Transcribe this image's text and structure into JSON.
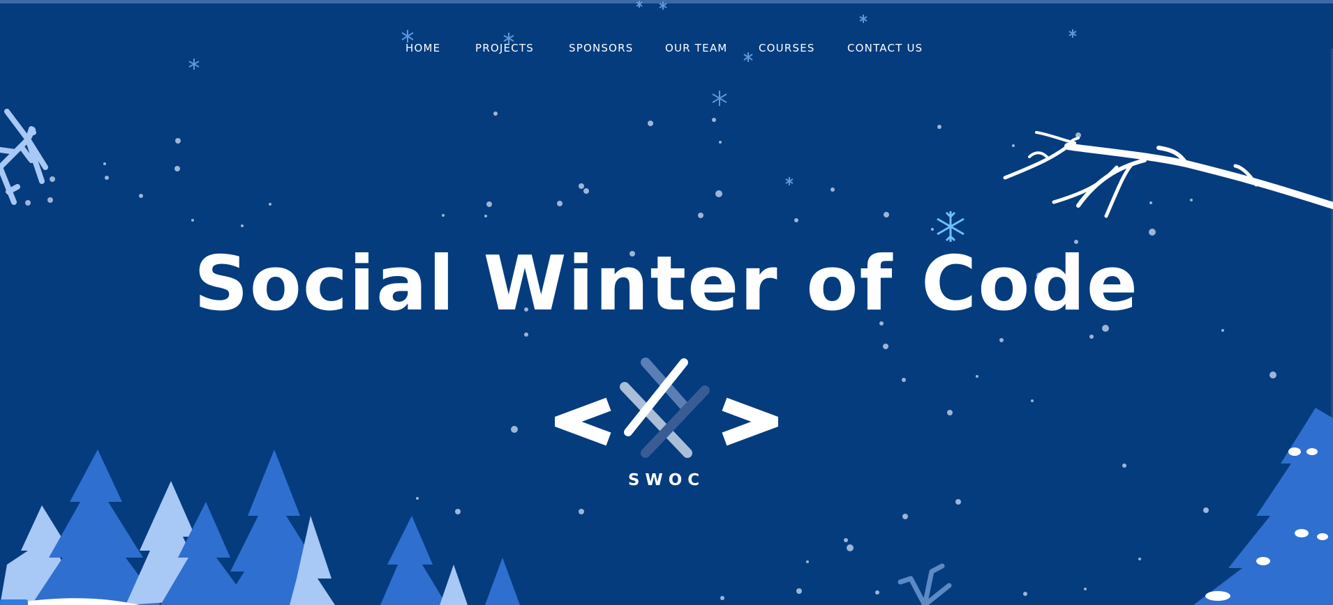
{
  "nav": {
    "items": [
      {
        "label": "HOME"
      },
      {
        "label": "PROJECTS"
      },
      {
        "label": "SPONSORS"
      },
      {
        "label": "OUR TEAM"
      },
      {
        "label": "COURSES"
      },
      {
        "label": "CONTACT US"
      }
    ]
  },
  "hero": {
    "title": "Social Winter of Code",
    "logo_text": "SWOC"
  },
  "colors": {
    "background": "#043c7e",
    "tree_dark": "#2f6fcf",
    "tree_light": "#a8c8f5",
    "text": "#ffffff"
  }
}
